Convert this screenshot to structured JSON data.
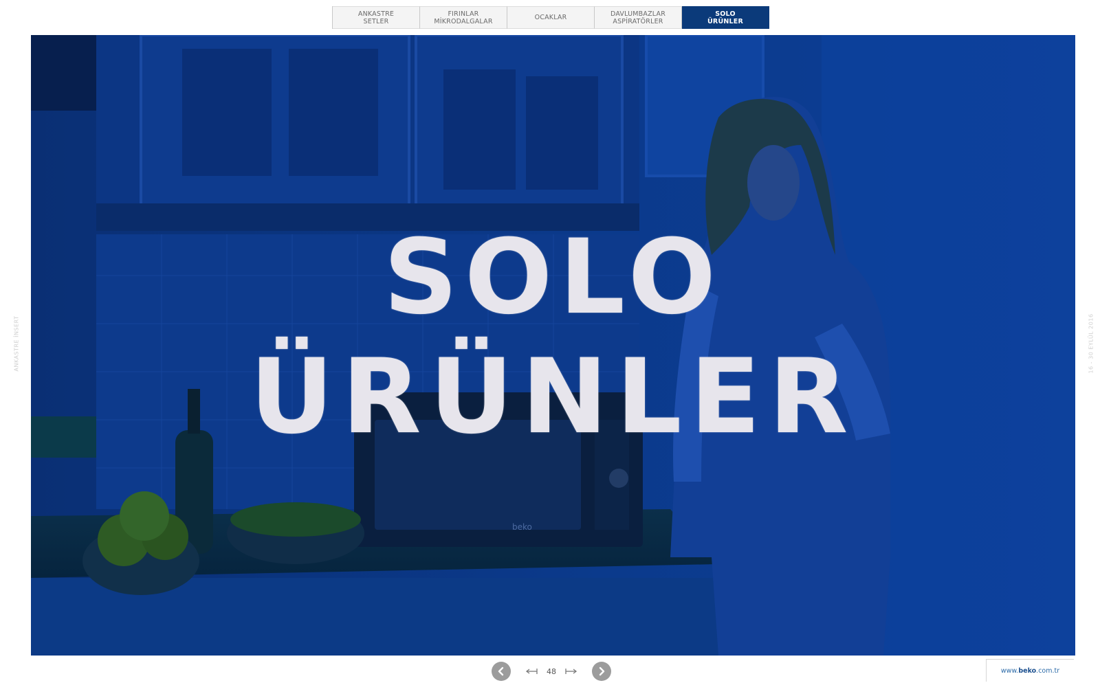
{
  "tabs": [
    {
      "label": "ANKASTRE\nSETLER",
      "active": false
    },
    {
      "label": "FIRINLAR\nMİKRODALGALAR",
      "active": false
    },
    {
      "label": "OCAKLAR",
      "active": false
    },
    {
      "label": "DAVLUMBAZLAR\nASPİRATÖRLER",
      "active": false
    },
    {
      "label": "SOLO\nÜRÜNLER",
      "active": true
    }
  ],
  "hero": {
    "title_line1": "SOLO",
    "title_line2": "ÜRÜNLER",
    "overlay_color": "#0a3a8c",
    "device_logo": "beko"
  },
  "side": {
    "left_label": "ANKASTRE İNSERT",
    "right_label": "16 - 30 EYLÜL 2016"
  },
  "pager": {
    "page_number": "48",
    "prev_icon": "chevron-left-circle-icon",
    "next_icon": "chevron-right-circle-icon",
    "first_icon": "jump-first-icon",
    "last_icon": "jump-last-icon"
  },
  "footer": {
    "url_prefix": "www.",
    "url_brand": "beko",
    "url_suffix": ".com.tr"
  },
  "colors": {
    "accent": "#0b3a7a",
    "hero_overlay": "#0a3a8c"
  }
}
